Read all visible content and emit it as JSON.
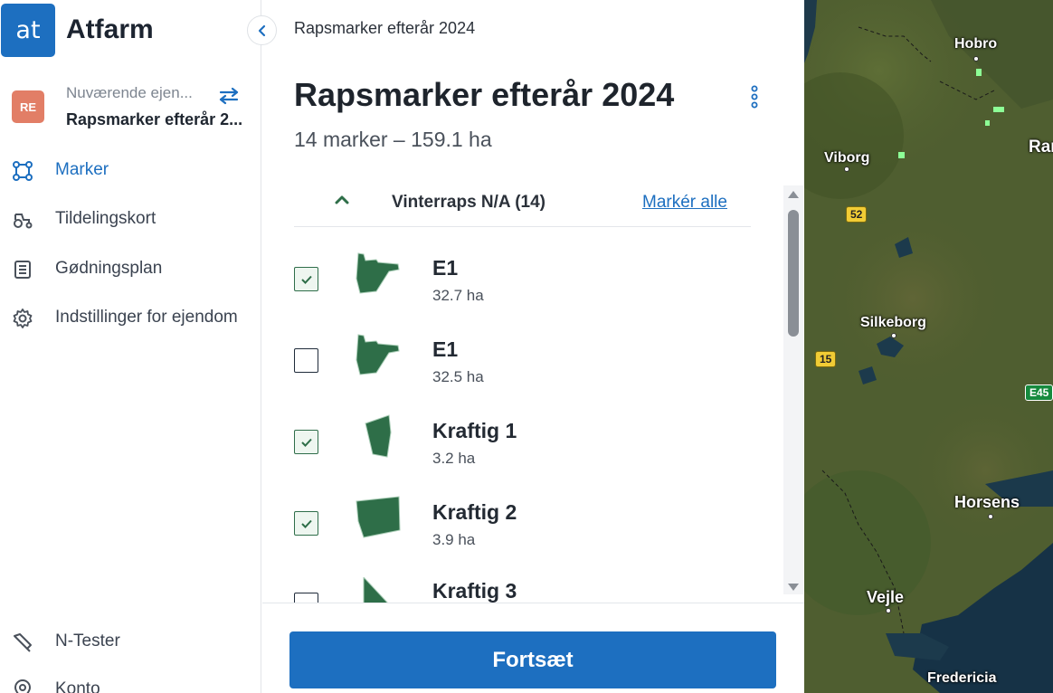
{
  "app": {
    "logo_text": "at",
    "name": "Atfarm"
  },
  "property": {
    "avatar": "RE",
    "label": "Nuværende ejen...",
    "name": "Rapsmarker efterår 2..."
  },
  "nav": [
    {
      "label": "Marker",
      "icon": "fields-icon",
      "active": true
    },
    {
      "label": "Tildelingskort",
      "icon": "tractor-icon",
      "active": false
    },
    {
      "label": "Gødningsplan",
      "icon": "document-icon",
      "active": false
    },
    {
      "label": "Indstillinger for ejendom",
      "icon": "gear-icon",
      "active": false
    }
  ],
  "nav_bottom": [
    {
      "label": "N-Tester",
      "icon": "n-tester-icon"
    },
    {
      "label": "Konto",
      "icon": "location-pin-icon"
    }
  ],
  "main": {
    "breadcrumb": "Rapsmarker efterår 2024",
    "title": "Rapsmarker efterår 2024",
    "subtitle": "14 marker – 159.1 ha",
    "group": {
      "name": "Vinterraps N/A (14)",
      "select_all": "Markér alle"
    },
    "fields": [
      {
        "name": "E1",
        "area": "32.7 ha",
        "checked": true
      },
      {
        "name": "E1",
        "area": "32.5 ha",
        "checked": false
      },
      {
        "name": "Kraftig 1",
        "area": "3.2 ha",
        "checked": true
      },
      {
        "name": "Kraftig 2",
        "area": "3.9 ha",
        "checked": true
      },
      {
        "name": "Kraftig 3",
        "area": "",
        "checked": false
      }
    ],
    "continue_label": "Fortsæt"
  },
  "map": {
    "cities": [
      "Hobro",
      "Viborg",
      "Ran",
      "Silkeborg",
      "Horsens",
      "Vejle",
      "Fredericia"
    ],
    "roads": [
      "52",
      "15",
      "E45"
    ]
  },
  "colors": {
    "accent": "#1d6fc0",
    "field": "#2e6e48",
    "avatar": "#e27e66"
  }
}
